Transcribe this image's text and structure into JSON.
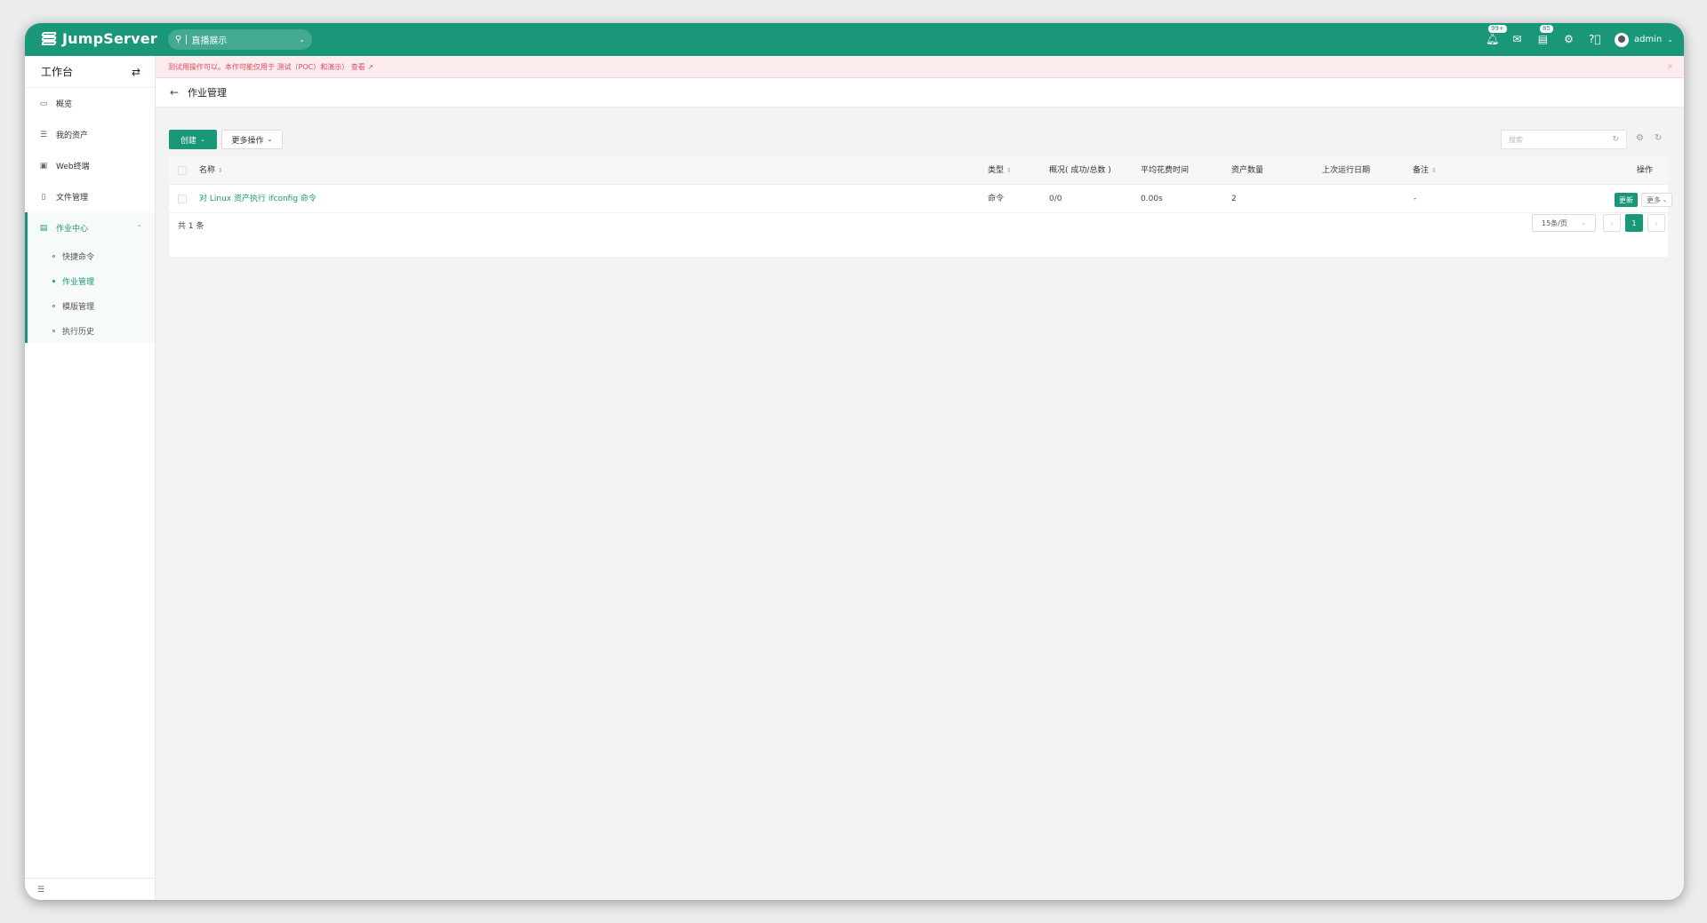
{
  "app": {
    "logo": "JumpServer",
    "org": "直播展示"
  },
  "header": {
    "badges": {
      "notifications": "99+",
      "messages": "85"
    },
    "user": "admin"
  },
  "sidebar": {
    "title": "工作台",
    "items": [
      {
        "label": "概览",
        "icon": "dashboard-icon"
      },
      {
        "label": "我的资产",
        "icon": "assets-icon"
      },
      {
        "label": "Web终端",
        "icon": "terminal-icon"
      },
      {
        "label": "文件管理",
        "icon": "file-icon"
      }
    ],
    "group": {
      "label": "作业中心",
      "children": [
        {
          "label": "快捷命令",
          "active": false
        },
        {
          "label": "作业管理",
          "active": true
        },
        {
          "label": "模版管理",
          "active": false
        },
        {
          "label": "执行历史",
          "active": false
        }
      ]
    }
  },
  "notice": {
    "text": "测试用操作可以。本作可能仅用于 测试（POC）和演示）  查看 ↗"
  },
  "page": {
    "title": "作业管理"
  },
  "toolbar": {
    "create_label": "创建",
    "more_label": "更多操作",
    "search_placeholder": "搜索"
  },
  "table": {
    "columns": [
      "名称",
      "类型",
      "概况( 成功/总数 )",
      "平均花费时间",
      "资产数量",
      "上次运行日期",
      "备注",
      "操作"
    ],
    "rows": [
      {
        "name": "对 Linux 资产执行 ifconfig 命令",
        "type": "命令",
        "summary": "0/0",
        "avg_time": "0.00s",
        "assets": "2",
        "last_run": "",
        "comment": "-",
        "update_label": "更新",
        "more_label": "更多"
      }
    ],
    "total": "共 1 条",
    "page_size": "15条/页",
    "current_page": "1"
  },
  "colors": {
    "brand": "#1a9678",
    "notice_bg": "#fdecee",
    "notice_text": "#e04b5a"
  }
}
